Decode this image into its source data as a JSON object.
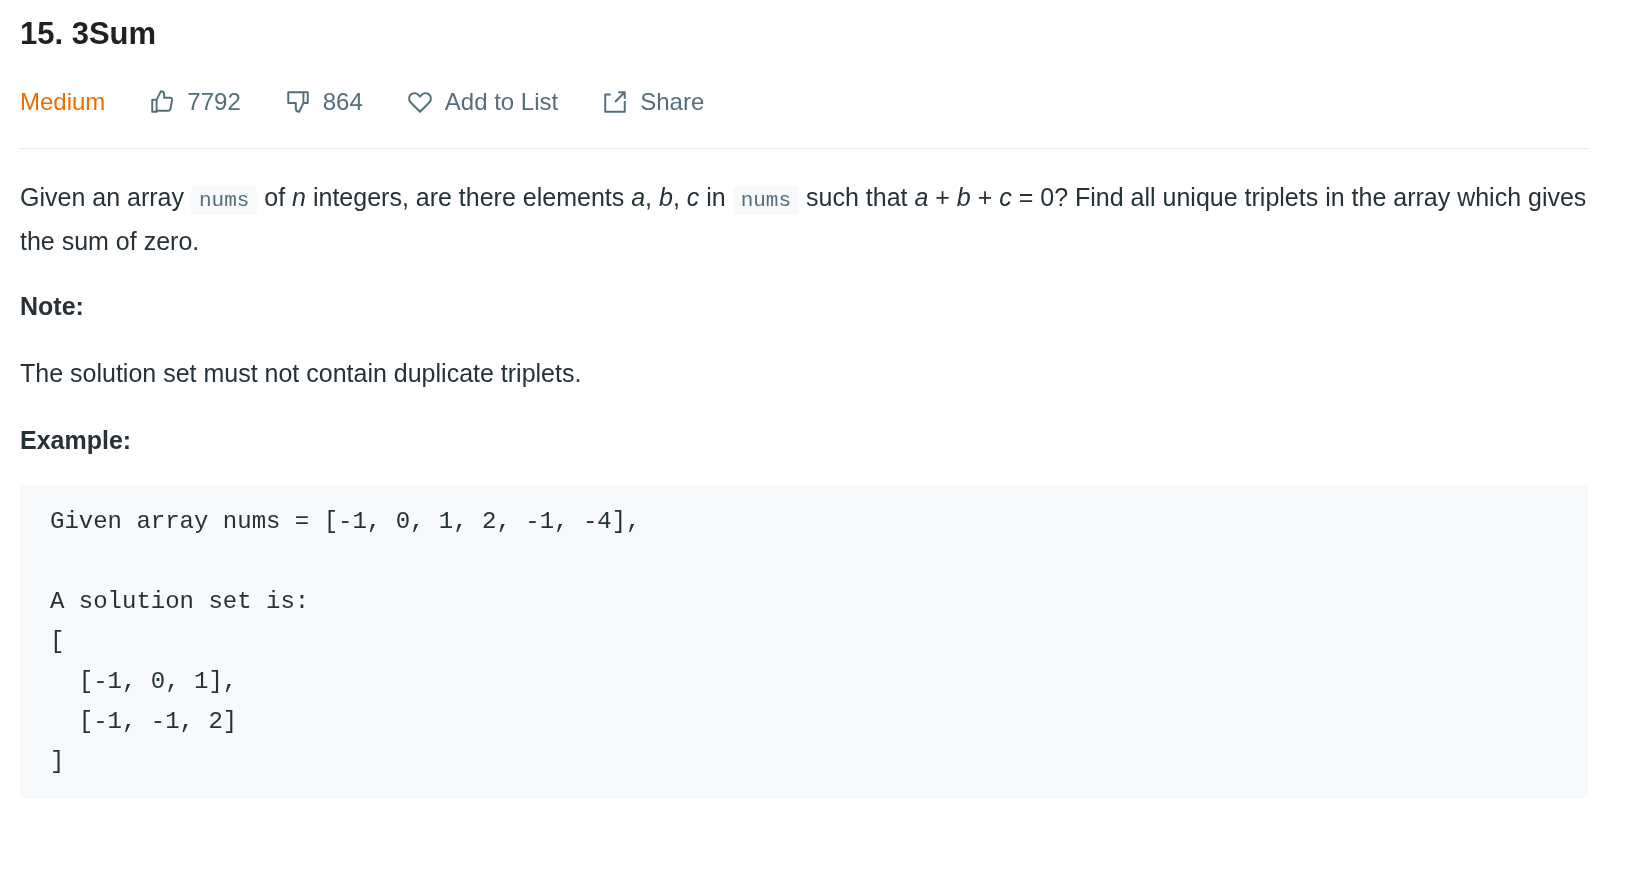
{
  "title": "15. 3Sum",
  "meta": {
    "difficulty": "Medium",
    "likes": "7792",
    "dislikes": "864",
    "add_to_list": "Add to List",
    "share": "Share"
  },
  "description": [
    {
      "kind": "text",
      "text": "Given an array "
    },
    {
      "kind": "code",
      "text": "nums"
    },
    {
      "kind": "text",
      "text": " of *n* integers, are there elements *a*, *b*, *c* in "
    },
    {
      "kind": "code",
      "text": "nums"
    },
    {
      "kind": "text",
      "text": " such that *a* + *b* + *c* = 0? Find all unique triplets in the array which gives the sum of zero."
    }
  ],
  "note_heading": "Note:",
  "note_text": "The solution set must not contain duplicate triplets.",
  "example_heading": "Example:",
  "example_code": "Given array nums = [-1, 0, 1, 2, -1, -4],\n\nA solution set is:\n[\n  [-1, 0, 1],\n  [-1, -1, 2]\n]"
}
